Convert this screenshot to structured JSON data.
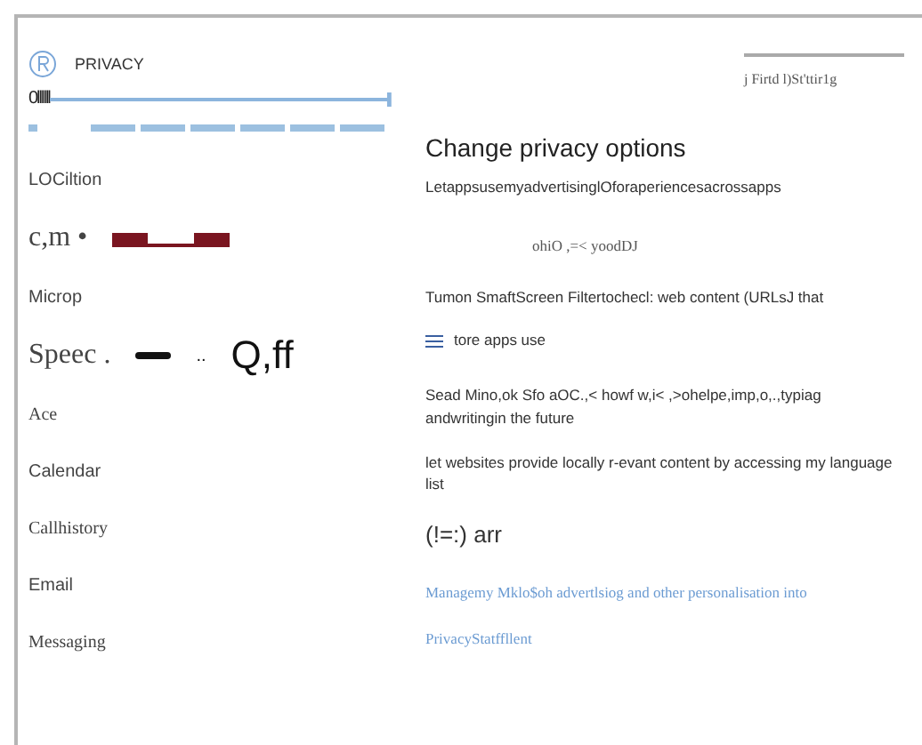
{
  "header": {
    "title": "PRIVACY",
    "progress_text": "0llllll"
  },
  "search": {
    "value": "j Firtd l)St'ttir1g"
  },
  "sidebar": {
    "items": [
      {
        "label": "LOCiltion",
        "kind": "sans"
      },
      {
        "label": "c,m •",
        "kind": "serif-large"
      },
      {
        "label": "Microp",
        "kind": "sans"
      },
      {
        "label": "Speec .",
        "kind": "serif-large",
        "extra": [
          "..",
          "Q,ff"
        ]
      },
      {
        "label": "Ace",
        "kind": "serif"
      },
      {
        "label": "Calendar",
        "kind": "sans"
      },
      {
        "label": "Callhistory",
        "kind": "serif"
      },
      {
        "label": "Email",
        "kind": "sans"
      },
      {
        "label": "Messaging",
        "kind": "serif"
      }
    ]
  },
  "main": {
    "heading": "Change privacy options",
    "settings": [
      {
        "kind": "text",
        "text": "LetappsusemyadvertisinglOforaperiencesacrossapps"
      },
      {
        "kind": "toggle",
        "text": "ohiO ,=< yoodDJ"
      },
      {
        "kind": "text",
        "text": "Tumon SmaftScreen Filtertochecl: web content (URLsJ that"
      },
      {
        "kind": "icon-text",
        "text": "tore apps use"
      },
      {
        "kind": "text",
        "text": "Sead Mino,ok Sfo aOC.,< howf w,i< ,>ohelpe,imp,o,.,typiag andwritingin the future"
      },
      {
        "kind": "text",
        "text": "let websites provide locally r-evant content by accessing my language list"
      },
      {
        "kind": "state",
        "text": "(!=:)  arr"
      },
      {
        "kind": "link",
        "text": "Managemy Mklo$oh advertlsiog and other personalisation into"
      },
      {
        "kind": "link",
        "text": "PrivacyStatffllent"
      }
    ]
  }
}
